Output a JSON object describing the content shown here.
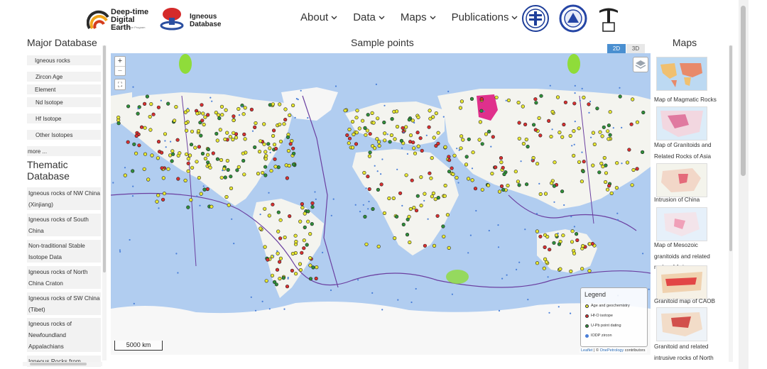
{
  "header": {
    "logo_dde": {
      "line1": "Deep-time",
      "line2": "Digital Earth",
      "line3": "IUGS Big Science Program"
    },
    "logo_igneous": {
      "line1": "Igneous",
      "line2": "Database"
    },
    "nav": [
      {
        "label": "About"
      },
      {
        "label": "Data"
      },
      {
        "label": "Maps"
      },
      {
        "label": "Publications"
      }
    ]
  },
  "left": {
    "major_title": "Major Database",
    "major_items": [
      "Igneous rocks",
      "Zircon Age",
      "Element",
      "Nd Isotope",
      "Hf Isotope",
      "Other Isotopes"
    ],
    "more": "more ...",
    "thematic_title": "Thematic Database",
    "thematic_items": [
      "Igneous rocks of NW China  (Xinjiang)",
      "Igneous rocks of South China",
      "Non-traditional Stable Isotope Data",
      "Igneous rocks of North China Craton",
      "Igneous rocks of SW China  (Tibet)",
      "Igneous rocks of Newfoundland Appalachians",
      "Igneous Rocks from"
    ]
  },
  "map": {
    "title": "Sample points",
    "toggle_2d": "2D",
    "toggle_3d": "3D",
    "scale": "5000 km",
    "legend_title": "Legend",
    "legend_items": [
      {
        "label": "Age and geochemistry",
        "color": "#e8e832"
      },
      {
        "label": "Hf-O isotope",
        "color": "#d93030"
      },
      {
        "label": "U-Pb point dating",
        "color": "#2f8f3a"
      },
      {
        "label": "IODP zircon",
        "color": "#4a7fd8"
      }
    ],
    "attribution_1": "Leaflet",
    "attribution_sep": " | © ",
    "attribution_2": "OnePetrology",
    "attribution_3": " contributors"
  },
  "right": {
    "title": "Maps",
    "maps": [
      "Map of Magmatic Rocks",
      "Map of Granitoids and Related Rocks of Asia",
      "Intrusion of China",
      "Map of Mesozoic granitoids and related rocks of Asia",
      "Granitoid map of CAOB",
      "Granitoid and related intrusive rocks of North"
    ]
  }
}
